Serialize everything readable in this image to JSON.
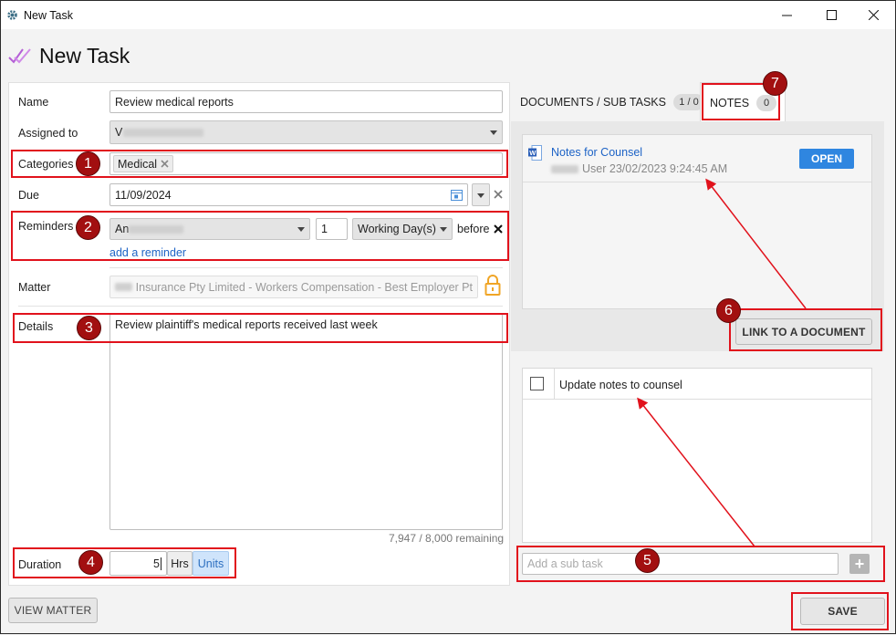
{
  "window": {
    "title": "New Task"
  },
  "header": {
    "title": "New Task"
  },
  "form": {
    "name": {
      "label": "Name",
      "value": "Review medical reports"
    },
    "assigned_to": {
      "label": "Assigned to",
      "value_prefix": "V"
    },
    "categories": {
      "label": "Categories",
      "tag": "Medical"
    },
    "due": {
      "label": "Due",
      "value": "11/09/2024"
    },
    "reminders": {
      "label": "Reminders",
      "who_prefix": "An",
      "count": "1",
      "unit": "Working Day(s)",
      "when": "before",
      "add_link": "add a reminder"
    },
    "matter": {
      "label": "Matter",
      "value": "Insurance Pty Limited - Workers Compensation - Best Employer Pt"
    },
    "details": {
      "label": "Details",
      "value": "Review plaintiff's medical reports received last week",
      "remaining": "7,947 / 8,000 remaining"
    },
    "duration": {
      "label": "Duration",
      "value": "5",
      "hrs_label": "Hrs",
      "units_label": "Units"
    }
  },
  "tabs": {
    "docs": {
      "label": "DOCUMENTS / SUB TASKS",
      "count": "1 / 0"
    },
    "notes": {
      "label": "NOTES",
      "count": "0"
    }
  },
  "document": {
    "title": "Notes for Counsel",
    "meta": "User 23/02/2023 9:24:45 AM",
    "open_label": "OPEN"
  },
  "link_document_label": "LINK TO A DOCUMENT",
  "subtasks": {
    "items": [
      {
        "label": "Update notes to counsel",
        "checked": false
      }
    ],
    "placeholder": "Add a sub task",
    "add_symbol": "+"
  },
  "buttons": {
    "view_matter": "VIEW MATTER",
    "save": "SAVE"
  },
  "annotations": {
    "badges": [
      "1",
      "2",
      "3",
      "4",
      "5",
      "6",
      "7"
    ]
  },
  "colors": {
    "highlight": "#e1121c",
    "badge": "#a20f10",
    "open_button": "#2f86e0",
    "link": "#1d63c6",
    "units_active": "#cfe4fb"
  }
}
